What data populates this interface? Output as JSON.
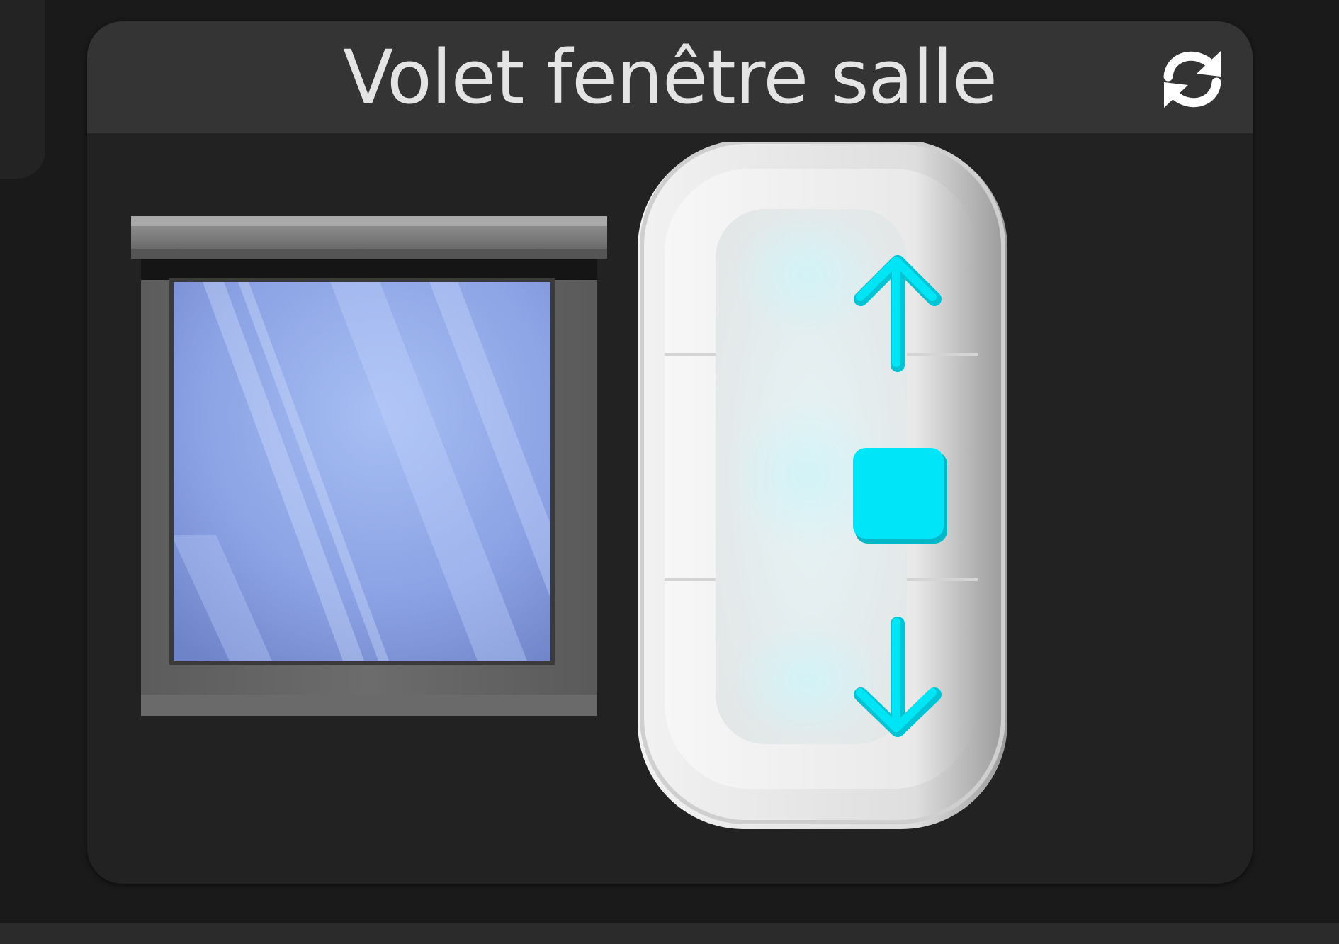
{
  "widget": {
    "title": "Volet fenêtre salle",
    "refresh_icon": "refresh-icon"
  },
  "window": {
    "icon": "window-shutter-icon"
  },
  "remote": {
    "up_icon": "arrow-up-icon",
    "stop_icon": "stop-square-icon",
    "down_icon": "arrow-down-icon"
  },
  "colors": {
    "accent": "#00E5F5",
    "card_bg": "#222222",
    "header_bg": "#343434",
    "title_text": "#E4E4E4",
    "glass": "#8FA8EA"
  }
}
